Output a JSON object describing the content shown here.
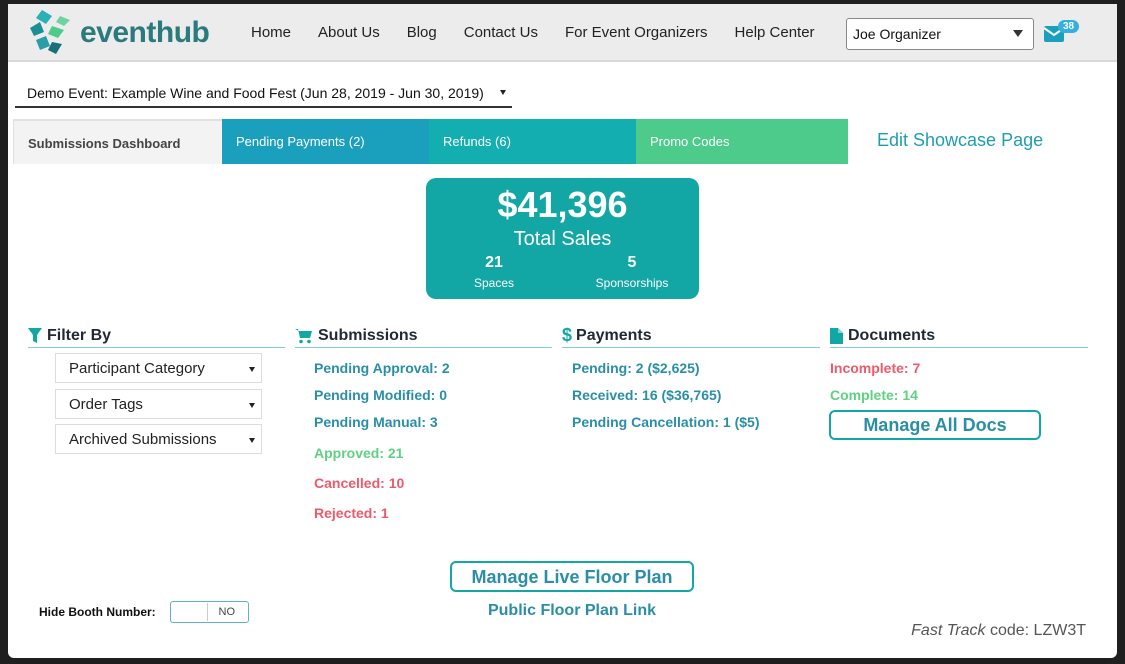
{
  "header": {
    "logo_text_event": "event",
    "logo_text_hub": "hub",
    "nav": [
      "Home",
      "About Us",
      "Blog",
      "Contact Us",
      "For Event Organizers",
      "Help Center"
    ],
    "user": "Joe Organizer",
    "mail_count": "38"
  },
  "event_selector": "Demo Event: Example Wine and Food Fest (Jun 28, 2019 - Jun 30, 2019)",
  "tabs": {
    "dashboard": "Submissions Dashboard",
    "pending": "Pending Payments (2)",
    "refunds": "Refunds (6)",
    "promo": "Promo Codes",
    "showcase": "Edit Showcase Page"
  },
  "sales": {
    "amount": "$41,396",
    "label": "Total Sales",
    "spaces_count": "21",
    "spaces_label": "Spaces",
    "sponsorships_count": "5",
    "sponsorships_label": "Sponsorships"
  },
  "filter": {
    "title": "Filter By",
    "options": [
      "Participant Category",
      "Order Tags",
      "Archived Submissions"
    ]
  },
  "submissions": {
    "title": "Submissions",
    "pending_approval": "Pending Approval: 2",
    "pending_modified": "Pending Modified: 0",
    "pending_manual": "Pending Manual: 3",
    "approved": "Approved: 21",
    "cancelled": "Cancelled: 10",
    "rejected": "Rejected: 1"
  },
  "payments": {
    "title": "Payments",
    "pending": "Pending: 2 ($2,625)",
    "received": "Received: 16 ($36,765)",
    "pending_cancellation": "Pending Cancellation: 1 ($5)"
  },
  "documents": {
    "title": "Documents",
    "incomplete": "Incomplete: 7",
    "complete": "Complete: 14",
    "manage_button": "Manage All Docs"
  },
  "floor_plan": {
    "manage_button": "Manage Live Floor Plan",
    "public_link": "Public Floor Plan Link"
  },
  "booth": {
    "label": "Hide Booth Number:",
    "toggle_state": "NO"
  },
  "fast_track": {
    "prefix": "Fast Track",
    "suffix": " code: LZW3T"
  },
  "colors": {
    "teal": "#12a7a4",
    "blue_tab": "#1a9fbd",
    "green_tab": "#4dcb8a",
    "link": "#2a8fa6",
    "approved": "#5fd084",
    "warning": "#ef5a6a"
  }
}
